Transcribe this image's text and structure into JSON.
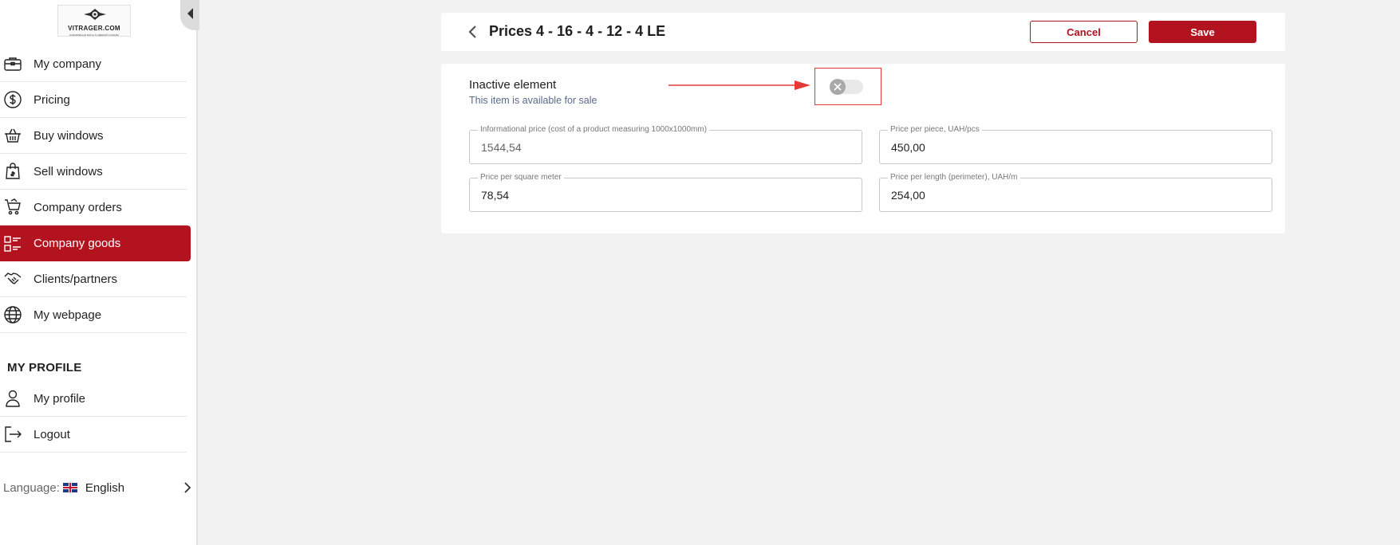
{
  "sidebar": {
    "logo": {
      "title": "VITRAGER.COM",
      "subtitle": "ЗАМОВЛЕННЯ ВІКОН ТА ДВЕРЕЙ ОНЛАЙН"
    },
    "items": [
      {
        "label": "My company",
        "icon": "briefcase-icon"
      },
      {
        "label": "Pricing",
        "icon": "dollar-coin-icon"
      },
      {
        "label": "Buy windows",
        "icon": "basket-icon"
      },
      {
        "label": "Sell windows",
        "icon": "shopping-bag-icon"
      },
      {
        "label": "Company orders",
        "icon": "cart-icon"
      },
      {
        "label": "Company goods",
        "icon": "goods-list-icon",
        "active": true
      },
      {
        "label": "Clients/partners",
        "icon": "handshake-icon"
      },
      {
        "label": "My webpage",
        "icon": "globe-icon"
      }
    ],
    "profile_section_title": "MY PROFILE",
    "profile_items": [
      {
        "label": "My profile",
        "icon": "user-icon"
      },
      {
        "label": "Logout",
        "icon": "logout-icon"
      }
    ],
    "language": {
      "label": "Language:",
      "value": "English",
      "flag": "uk-flag-icon"
    }
  },
  "header": {
    "title": "Prices 4 - 16 - 4 - 12 - 4 LE",
    "cancel_label": "Cancel",
    "save_label": "Save"
  },
  "form": {
    "inactive": {
      "label": "Inactive element",
      "description": "This item is available for sale",
      "toggle_on": false
    },
    "fields": {
      "informational_price": {
        "label": "Informational price (cost of a product measuring 1000x1000mm)",
        "value": "1544,54"
      },
      "price_per_piece": {
        "label": "Price per piece, UAH/pcs",
        "value": "450,00"
      },
      "price_per_sqm": {
        "label": "Price per square meter",
        "value": "78,54"
      },
      "price_per_length": {
        "label": "Price per length (perimeter), UAH/m",
        "value": "254,00"
      }
    }
  },
  "colors": {
    "accent": "#b3121f",
    "highlight": "#e53935",
    "background": "#f2f2f2"
  }
}
